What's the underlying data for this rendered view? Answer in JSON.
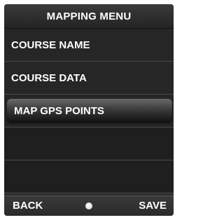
{
  "header": {
    "title": "MAPPING MENU"
  },
  "menu": {
    "items": [
      {
        "label": "COURSE NAME",
        "selected": false
      },
      {
        "label": "COURSE DATA",
        "selected": false
      },
      {
        "label": "MAP GPS POINTS",
        "selected": true
      },
      {
        "label": "",
        "selected": false
      },
      {
        "label": "",
        "selected": false
      }
    ]
  },
  "footer": {
    "back_label": "BACK",
    "save_label": "SAVE",
    "center_icon": "dot-icon"
  },
  "colors": {
    "background": "#2b2b2b",
    "text": "#ffffff",
    "highlight": "#3a3a3a"
  }
}
